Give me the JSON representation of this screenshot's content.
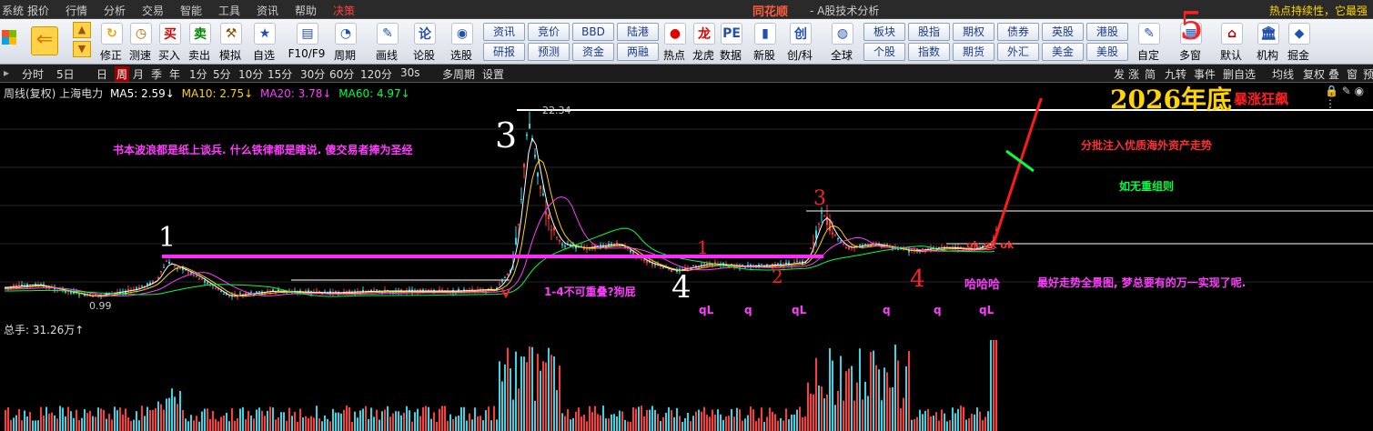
{
  "menu": [
    "系统",
    "报价",
    "行情",
    "分析",
    "交易",
    "智能",
    "工具",
    "资讯",
    "帮助",
    "决策"
  ],
  "app_title": "同花顺",
  "app_subtitle": "- A股技术分析",
  "top_right": "热点持续性，它最强",
  "toolbar_icons": [
    {
      "label": "修正",
      "icon": "refresh-icon",
      "glyph": "↻",
      "color": "#f0a000"
    },
    {
      "label": "测速",
      "icon": "clock-icon",
      "glyph": "◷",
      "color": "#b06000"
    },
    {
      "label": "买入",
      "icon": "buy-icon",
      "glyph": "买",
      "color": "#e00000"
    },
    {
      "label": "卖出",
      "icon": "sell-icon",
      "glyph": "卖",
      "color": "#008a00"
    },
    {
      "label": "模拟",
      "icon": "gavel-icon",
      "glyph": "⚒",
      "color": "#8a4b00"
    },
    {
      "label": "自选",
      "icon": "star-icon",
      "glyph": "★",
      "color": "#2050b0"
    },
    {
      "label": "F10/F9",
      "icon": "f10-icon",
      "glyph": "▤",
      "color": "#2050b0"
    },
    {
      "label": "周期",
      "icon": "cycle-icon",
      "glyph": "◔",
      "color": "#2050b0"
    },
    {
      "label": "画线",
      "icon": "pencil-icon",
      "glyph": "✎",
      "color": "#2050b0"
    },
    {
      "label": "论股",
      "icon": "discuss-icon",
      "glyph": "论",
      "color": "#2050b0"
    },
    {
      "label": "选股",
      "icon": "select-icon",
      "glyph": "◉",
      "color": "#2050b0"
    }
  ],
  "toolbar_buttons_top": [
    "资讯",
    "竞价",
    "BBD",
    "陆港"
  ],
  "toolbar_buttons_bottom": [
    "研报",
    "预测",
    "资金",
    "两融"
  ],
  "toolbar_icons2": [
    {
      "label": "热点",
      "icon": "hot-icon",
      "glyph": "●",
      "color": "#e00000"
    },
    {
      "label": "龙虎",
      "icon": "dragon-icon",
      "glyph": "龙",
      "color": "#e00000"
    },
    {
      "label": "数据",
      "icon": "pe-icon",
      "glyph": "PE",
      "color": "#2050b0"
    },
    {
      "label": "新股",
      "icon": "newstock-icon",
      "glyph": "▮",
      "color": "#2050b0"
    },
    {
      "label": "创/科",
      "icon": "chuang-icon",
      "glyph": "创",
      "color": "#2050b0"
    },
    {
      "label": "全球",
      "icon": "globe-icon",
      "glyph": "◍",
      "color": "#2050b0"
    }
  ],
  "toolbar_buttons2_top": [
    "板块",
    "股指",
    "期权",
    "债券",
    "英股",
    "港股"
  ],
  "toolbar_buttons2_bottom": [
    "个股",
    "指数",
    "期货",
    "外汇",
    "美金",
    "美股"
  ],
  "toolbar_icons3": [
    {
      "label": "自定",
      "icon": "custom-icon",
      "glyph": "✎",
      "color": "#2050b0"
    },
    {
      "label": "多窗",
      "icon": "multiwindow-icon",
      "glyph": "▦",
      "color": "#2050b0"
    },
    {
      "label": "默认",
      "icon": "home-icon",
      "glyph": "⌂",
      "color": "#b00000"
    },
    {
      "label": "机构",
      "icon": "bank-icon",
      "glyph": "🏛",
      "color": "#2050b0"
    },
    {
      "label": "掘金",
      "icon": "gold-icon",
      "glyph": "◆",
      "color": "#2050b0"
    }
  ],
  "periods": [
    "分时",
    "5日",
    "日",
    "周",
    "月",
    "季",
    "年",
    "1分",
    "5分",
    "10分",
    "15分",
    "30分",
    "60分",
    "120分",
    "30s",
    "多周期",
    "设置"
  ],
  "active_period": "周",
  "right_tabs": [
    "发",
    "涨",
    "简",
    "九转",
    "事件",
    "删自选",
    "均线",
    "复权",
    "叠",
    "窗",
    "预"
  ],
  "legend": {
    "name": "周线(复权) 上海电力",
    "ma5": "MA5: 2.59↓",
    "ma10": "MA10: 2.75↓",
    "ma20": "MA20: 3.78↓",
    "ma60": "MA60: 4.97↓"
  },
  "price_labels": {
    "high": "22.34",
    "low": "0.99"
  },
  "volume_label": "总手: 31.26万↑",
  "annotations": {
    "magenta_note": "书本波浪都是纸上谈兵. 什么铁律都是瞎说. 傻交易者捧为圣经",
    "no_overlap": "1-4不可重叠?狗屁",
    "inject": "分批注入优质海外资产走势",
    "no_reorg": "如无重组则",
    "haha": "哈哈哈",
    "best": "最好走势全景图, 梦总要有的万一实现了呢.",
    "surge": "暴涨狂飙",
    "year_end": "2026年底",
    "ok": "ok ok ok",
    "wave1": "1",
    "wave3": "3",
    "wave4": "4",
    "wave5": "5",
    "r3": "3",
    "r1": "1",
    "r2": "2",
    "r4": "4",
    "q_markers": [
      "qL",
      "q",
      "qL",
      "q",
      "q",
      "qL"
    ]
  },
  "chart_data": {
    "type": "candlestick",
    "title": "",
    "ylabel": "",
    "y_max_label": 22.34,
    "y_min_label": 0.99
  },
  "colors": {
    "up": "#ff3b3b",
    "down": "#36d6e7",
    "ma5": "#ffffff",
    "ma10": "#ffd400",
    "ma20": "#ff3dff",
    "ma60": "#00ff44",
    "magenta": "#ff3dff",
    "red": "#ff1a1a",
    "yellow": "#ffd400"
  }
}
